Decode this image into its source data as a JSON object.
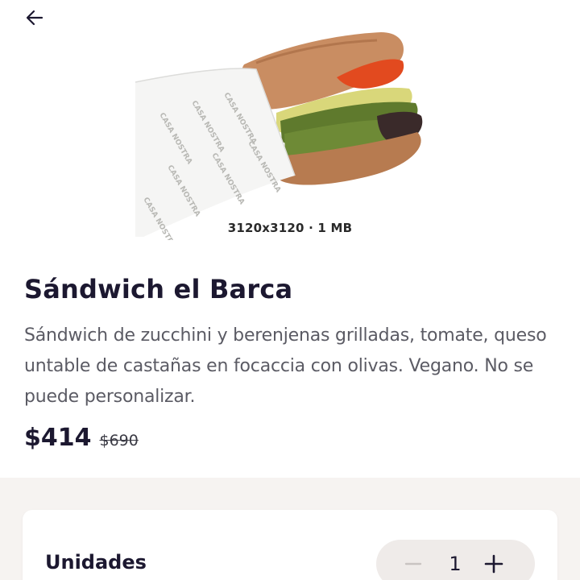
{
  "header": {
    "back_icon": "arrow-left-icon"
  },
  "product": {
    "image_caption": "3120x3120 · 1 MB",
    "title": "Sándwich el Barca",
    "description": "Sándwich de zucchini y berenjenas grilladas, tomate, queso untable de castañas en focaccia con olivas. Vegano. No se puede personalizar.",
    "price": "$414",
    "old_price": "$690"
  },
  "units": {
    "label": "Unidades",
    "quantity": "1",
    "minus_icon": "minus-icon",
    "plus_icon": "plus-icon"
  },
  "colors": {
    "text_dark": "#1c1830",
    "text_muted": "#5b5b64",
    "background_lower": "#f6f3f1",
    "stepper_bg": "#efebe9"
  }
}
